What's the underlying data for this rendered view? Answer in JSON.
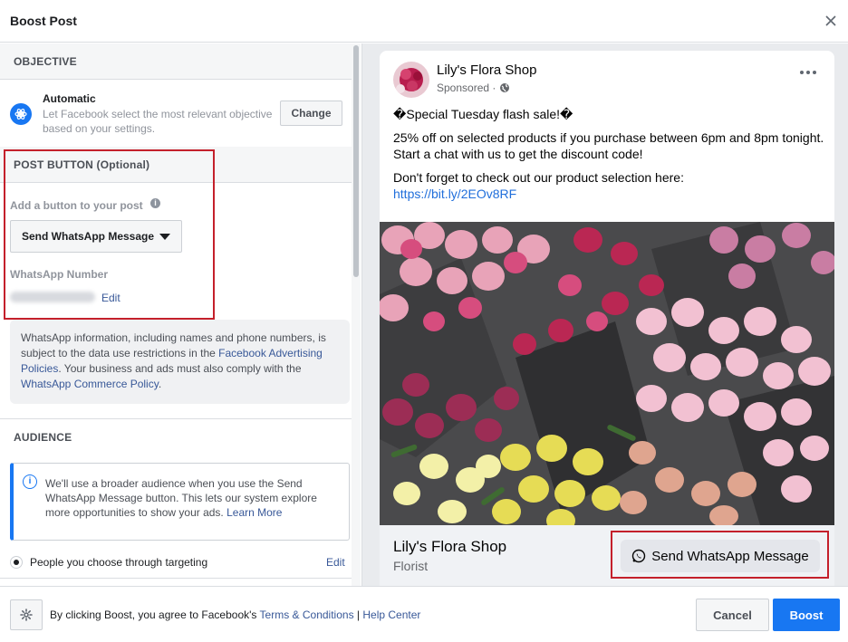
{
  "header": {
    "title": "Boost Post"
  },
  "objective": {
    "section_title": "OBJECTIVE",
    "name": "Automatic",
    "description": "Let Facebook select the most relevant objective based on your settings.",
    "change_label": "Change"
  },
  "post_button": {
    "section_title": "POST BUTTON (Optional)",
    "add_label": "Add a button to your post",
    "selected_button": "Send WhatsApp Message",
    "number_label": "WhatsApp Number",
    "edit_label": "Edit"
  },
  "notice": {
    "text_1": "WhatsApp information, including names and phone numbers, is subject to the data use restrictions in the ",
    "link_1": "Facebook Advertising Policies",
    "text_2": ". Your business and ads must also comply with the ",
    "link_2": "WhatsApp Commerce Policy",
    "text_3": "."
  },
  "audience": {
    "section_title": "AUDIENCE",
    "info_text": "We'll use a broader audience when you use the Send WhatsApp Message button. This lets our system explore more opportunities to show your ads. ",
    "learn_more": "Learn More",
    "option_label": "People you choose through targeting",
    "edit_label": "Edit"
  },
  "preview": {
    "page_name": "Lily's Flora Shop",
    "sponsored": "Sponsored ·",
    "line_1": "�Special Tuesday flash sale!�",
    "line_2": "25% off on selected products if you purchase between 6pm and 8pm tonight. Start a chat with us to get the discount code!",
    "line_3": "Don't forget to check out our product selection here:",
    "link": "https://bit.ly/2EOv8RF",
    "cta_name": "Lily's Flora Shop",
    "cta_category": "Florist",
    "cta_button": "Send WhatsApp Message"
  },
  "footer": {
    "agree_prefix": "By clicking Boost, you agree to Facebook's ",
    "terms_link": "Terms & Conditions",
    "separator": " | ",
    "help_link": "Help Center",
    "cancel_label": "Cancel",
    "boost_label": "Boost"
  },
  "colors": {
    "accent": "#1877f2",
    "highlight": "#c4202b",
    "link": "#385898"
  }
}
